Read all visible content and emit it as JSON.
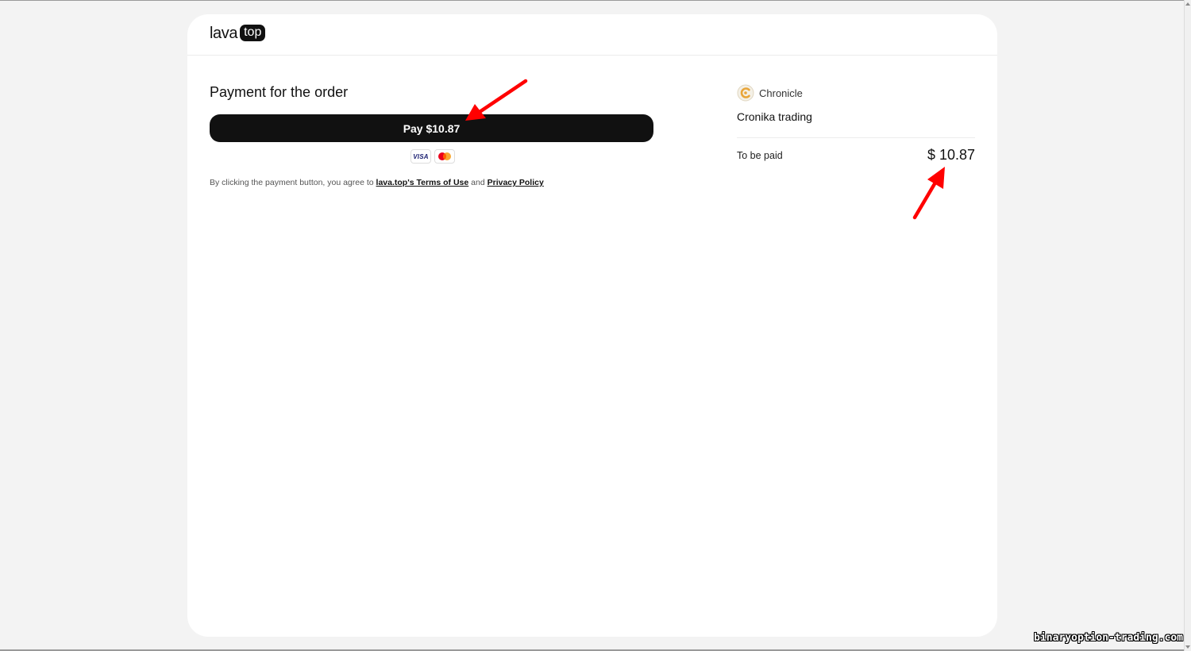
{
  "header": {
    "logo_text": "lava",
    "logo_badge": "top"
  },
  "payment": {
    "title": "Payment for the order",
    "pay_button_label": "Pay $10.87",
    "card_brands": [
      "VISA",
      "mastercard-icon"
    ],
    "terms_prefix": "By clicking the payment button, you agree to",
    "terms_link": "lava.top's Terms of Use",
    "terms_and": "and",
    "privacy_link": "Privacy Policy"
  },
  "summary": {
    "merchant_name": "Chronicle",
    "product_name": "Cronika trading",
    "to_be_paid_label": "To be paid",
    "to_be_paid_amount": "$ 10.87"
  },
  "annotations": {
    "arrow_color": "#ff0000"
  },
  "watermark": "binaryoption-trading.com"
}
